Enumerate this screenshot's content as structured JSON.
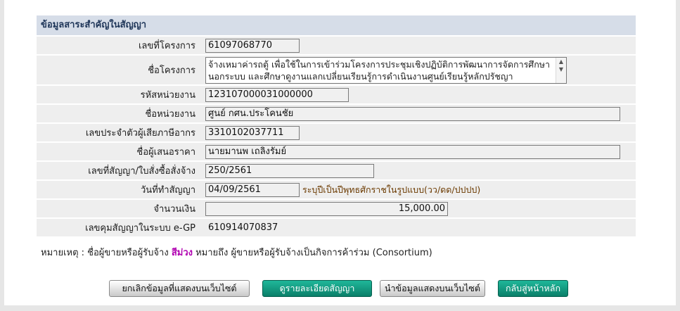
{
  "section_title": "ข้อมูลสาระสำคัญในสัญญา",
  "fields": {
    "project_no": {
      "label": "เลขที่โครงการ",
      "value": "61097068770"
    },
    "project_name": {
      "label": "ชื่อโครงการ",
      "value": "จ้างเหมาค่ารถตู้  เพื่อใช้ในการเข้าร่วมโครงการประชุมเชิงปฏิบัติการพัฒนาการจัดการศึกษานอกระบบ และศึกษาดูงานแลกเปลี่ยนเรียนรู้การดำเนินงานศูนย์เรียนรู้หลักปรัชญา"
    },
    "agency_code": {
      "label": "รหัสหน่วยงาน",
      "value": "123107000031000000"
    },
    "agency_name": {
      "label": "ชื่อหน่วยงาน",
      "value": "ศูนย์ กศน.ประโคนชัย"
    },
    "tax_id": {
      "label": "เลขประจำตัวผู้เสียภาษีอากร",
      "value": "3310102037711"
    },
    "bidder_name": {
      "label": "ชื่อผู้เสนอราคา",
      "value": "นายมานพ  เถลิงรัมย์"
    },
    "contract_no": {
      "label": "เลขที่สัญญา/ใบสั่งซื้อสั่งจ้าง",
      "value": "250/2561"
    },
    "contract_date": {
      "label": "วันที่ทำสัญญา",
      "value": "04/09/2561",
      "hint": "ระบุปีเป็นปีพุทธศักราชในรูปแบบ(วว/ดด/ปปปป)"
    },
    "amount": {
      "label": "จำนวนเงิน",
      "value": "15,000.00"
    },
    "egp_control_no": {
      "label": "เลขคุมสัญญาในระบบ e-GP",
      "value": "610914070837"
    }
  },
  "note": {
    "prefix": "หมายเหตุ : ชื่อผู้ขายหรือผู้รับจ้าง ",
    "highlight": "สีม่วง",
    "suffix": " หมายถึง ผู้ขายหรือผู้รับจ้างเป็นกิจการค้าร่วม (Consortium)"
  },
  "buttons": {
    "cancel": "ยกเลิกข้อมูลที่แสดงบนเว็บไซต์",
    "detail": "ดูรายละเอียดสัญญา",
    "publish": "นำข้อมูลแสดงบนเว็บไซต์",
    "home": "กลับสู่หน้าหลัก"
  },
  "colors": {
    "header_bg": "#d6dde8",
    "row_bg": "#eeeeee",
    "teal_button": "#0b9b80",
    "consortium_purple": "#b000b0"
  }
}
